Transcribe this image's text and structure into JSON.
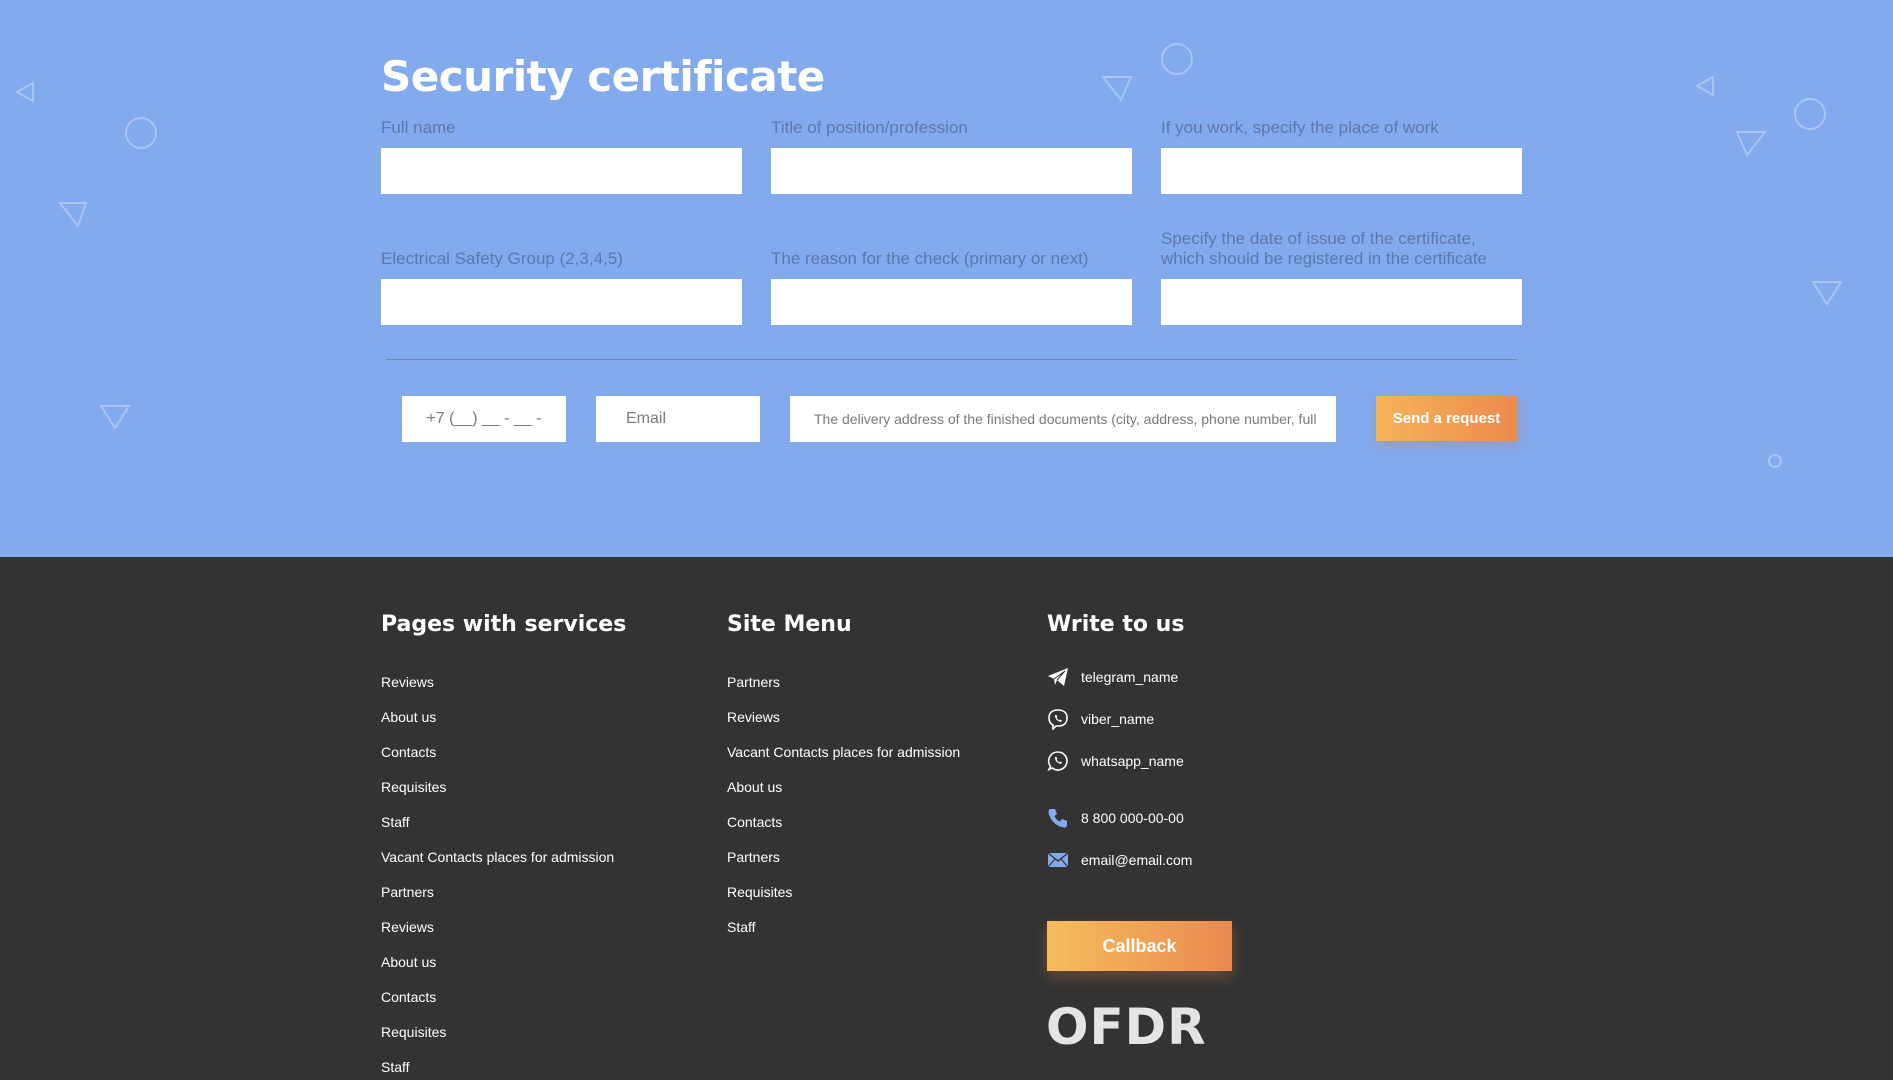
{
  "form": {
    "title": "Security certificate",
    "fields": [
      {
        "label": "Full name",
        "value": ""
      },
      {
        "label": "Title of position/profession",
        "value": ""
      },
      {
        "label": "If you work, specify the place of work",
        "value": ""
      },
      {
        "label": "Electrical Safety Group (2,3,4,5)",
        "value": ""
      },
      {
        "label": "The reason for the check (primary or next)",
        "value": ""
      },
      {
        "label_line1": "Specify the date of issue of the certificate,",
        "label_line2": "which should be registered in the certificate",
        "value": ""
      }
    ],
    "phone_placeholder": "+7 (__) __ - __ -",
    "email_placeholder": "Email",
    "address_placeholder": "The delivery address of the finished documents (city, address, phone number, full name)",
    "send_label": "Send a request"
  },
  "footer": {
    "services": {
      "title": "Pages with services",
      "items": [
        "Reviews",
        "About us",
        "Contacts",
        "Requisites",
        "Staff",
        "Vacant Contacts places for admission",
        "Partners",
        "Reviews",
        "About us",
        "Contacts",
        "Requisites",
        "Staff"
      ]
    },
    "menu": {
      "title": "Site Menu",
      "items": [
        "Partners",
        "Reviews",
        "Vacant Contacts places for admission",
        "About us",
        "Contacts",
        "Partners",
        "Requisites",
        "Staff"
      ]
    },
    "contacts": {
      "title": "Write to us",
      "telegram": "telegram_name",
      "viber": "viber_name",
      "whatsapp": "whatsapp_name",
      "phone": "8 800 000-00-00",
      "email": "email@email.com",
      "icons": [
        "telegram-icon",
        "viber-icon",
        "whatsapp-icon",
        "phone-icon",
        "mail-icon"
      ]
    },
    "callback_label": "Callback",
    "logo": "OFDR"
  },
  "colors": {
    "form_background": "#84aaee",
    "footer_background": "#333333",
    "accent_start": "#f6b45a",
    "accent_end": "#ee8a4e",
    "contact_icon": "#84aaee"
  }
}
